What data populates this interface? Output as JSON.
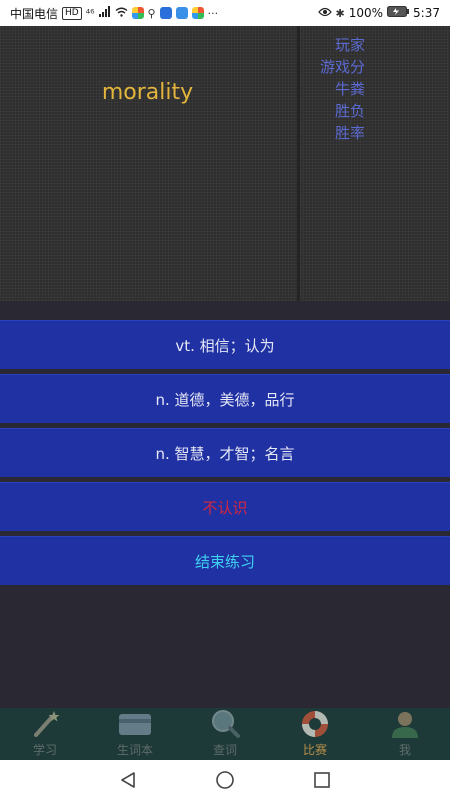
{
  "status_bar": {
    "carrier": "中国电信",
    "hd": "HD",
    "signal": "⁴⁶",
    "dots": "···",
    "battery": "100%",
    "time": "5:37"
  },
  "word": "morality",
  "score_panel": {
    "items": [
      "玩家",
      "游戏分",
      "牛粪",
      "胜负",
      "胜率"
    ]
  },
  "options": [
    {
      "label": "vt. 相信；认为"
    },
    {
      "label": "n. 道德，美德，品行"
    },
    {
      "label": "n. 智慧，才智；名言"
    }
  ],
  "unknown_label": "不认识",
  "end_label": "结束练习",
  "colors": {
    "word": "#e3b53c",
    "option_bg": "#1f31a3",
    "unknown": "#d5263f",
    "end": "#3fd2f0",
    "nav_bg": "#1d3a39",
    "active_label": "#b58e4a"
  },
  "bottom_nav": {
    "items": [
      {
        "label": "学习",
        "icon": "magic-wand-icon"
      },
      {
        "label": "生词本",
        "icon": "card-icon"
      },
      {
        "label": "查词",
        "icon": "magnifier-icon"
      },
      {
        "label": "比赛",
        "icon": "lifebuoy-icon"
      },
      {
        "label": "我",
        "icon": "person-icon"
      }
    ],
    "active": "比赛"
  }
}
